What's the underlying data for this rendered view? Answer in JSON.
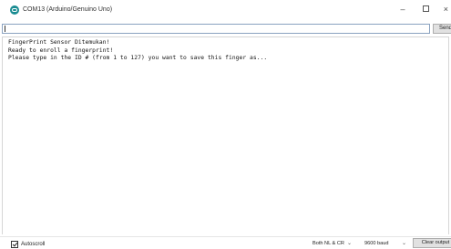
{
  "window": {
    "title": "COM13 (Arduino/Genuino Uno)",
    "minimize_glyph": "–",
    "close_glyph": "×"
  },
  "input": {
    "value": "",
    "send_label": "Send"
  },
  "output": {
    "lines": [
      "FingerPrint Sensor Ditemukan!",
      "Ready to enroll a fingerprint!",
      "Please type in the ID # (from 1 to 127) you want to save this finger as..."
    ]
  },
  "statusbar": {
    "autoscroll_label": "Autoscroll",
    "autoscroll_checked": true,
    "line_ending": "Both NL & CR",
    "baud_rate": "9600 baud",
    "clear_label": "Clear output"
  },
  "icons": {
    "app": "arduino-icon",
    "dropdown": "chevron-down-icon"
  },
  "colors": {
    "app_icon": "#1a8c92",
    "input_border": "#8aa2c0"
  }
}
